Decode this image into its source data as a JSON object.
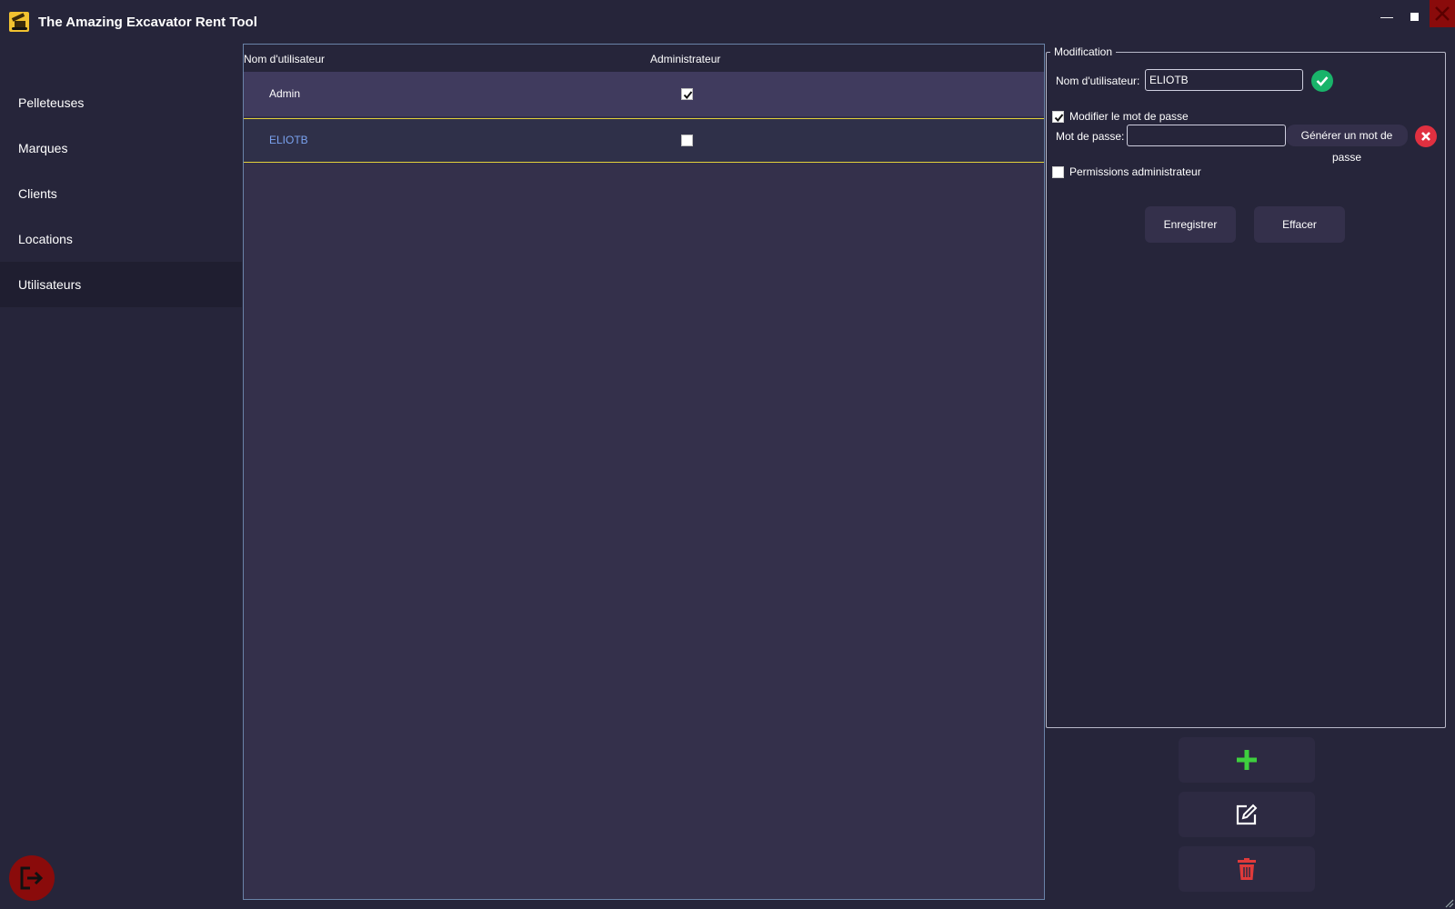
{
  "window": {
    "title": "The Amazing Excavator Rent Tool",
    "minimize": "—",
    "maximize": "■",
    "close": "✕"
  },
  "sidebar": {
    "items": [
      {
        "label": "Pelleteuses"
      },
      {
        "label": "Marques"
      },
      {
        "label": "Clients"
      },
      {
        "label": "Locations"
      },
      {
        "label": "Utilisateurs",
        "active": true
      }
    ]
  },
  "table": {
    "columns": [
      "Nom d'utilisateur",
      "Administrateur"
    ],
    "rows": [
      {
        "username": "Admin",
        "is_admin": true
      },
      {
        "username": "ELIOTB",
        "is_admin": false,
        "selected": true
      }
    ]
  },
  "modification": {
    "legend": "Modification",
    "username_label": "Nom d'utilisateur:",
    "username_value": "ELIOTB",
    "change_password_label": "Modifier le mot de passe",
    "change_password_checked": true,
    "password_label": "Mot de passe:",
    "password_value": "",
    "generate_password_label": "Générer un mot de passe",
    "admin_permissions_label": "Permissions administrateur",
    "admin_permissions_checked": false,
    "save_label": "Enregistrer",
    "clear_label": "Effacer"
  },
  "colors": {
    "background": "#26253a",
    "table_bg": "#34304b",
    "row_admin_bg": "#403b5e",
    "selection_border": "#e3d23a",
    "selected_text": "#7aa2ef",
    "add": "#3ecf3e",
    "delete": "#e03a3a",
    "valid": "#19b46a",
    "cancel": "#e03040",
    "logout": "#8a0b0b"
  },
  "icons": {
    "app": "excavator-icon",
    "add": "plus-icon",
    "edit": "edit-icon",
    "delete": "trash-icon",
    "logout": "logout-icon",
    "valid": "check-circle-icon",
    "cancel": "x-circle-icon"
  }
}
